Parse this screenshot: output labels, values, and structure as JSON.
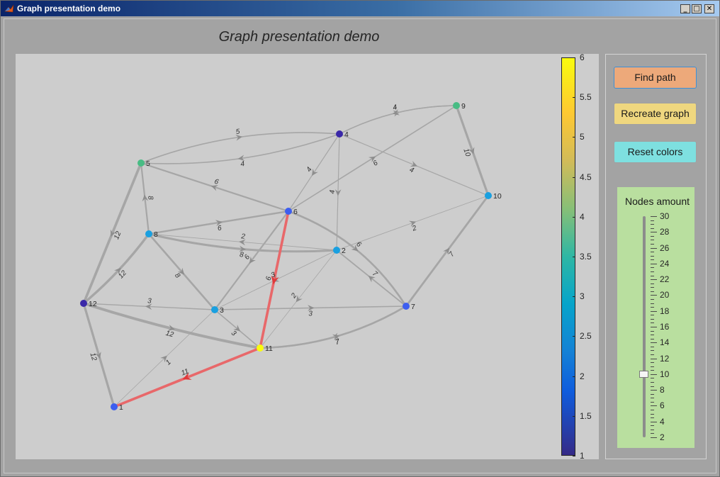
{
  "window": {
    "title": "Graph presentation demo"
  },
  "figure": {
    "title": "Graph presentation demo"
  },
  "buttons": {
    "find_path": "Find path",
    "recreate_graph": "Recreate graph",
    "reset_colors": "Reset colors"
  },
  "slider": {
    "title": "Nodes amount",
    "value": 10,
    "min": 2,
    "max": 30,
    "tick_labels": [
      "30",
      "28",
      "26",
      "24",
      "22",
      "20",
      "18",
      "16",
      "14",
      "12",
      "10",
      "8",
      "6",
      "4",
      "2"
    ]
  },
  "colorbar": {
    "tick_labels": [
      "6",
      "5.5",
      "5",
      "4.5",
      "4",
      "3.5",
      "3",
      "2.5",
      "2",
      "1.5",
      "1"
    ],
    "colors": [
      "#352a87",
      "#0f5cdd",
      "#1481d6",
      "#06a4ca",
      "#2eb7a4",
      "#87bf77",
      "#d1bb59",
      "#fec832",
      "#f9fb0e"
    ]
  },
  "colors": {
    "edge": "#a6a6a6",
    "path": "#e8686a",
    "node_label": "#262626"
  },
  "graph": {
    "nodes": [
      {
        "id": "1",
        "color": "#3d5ef0"
      },
      {
        "id": "2",
        "color": "#1aa0e0"
      },
      {
        "id": "3",
        "color": "#1aa0e0"
      },
      {
        "id": "4",
        "color": "#3a28a8"
      },
      {
        "id": "5",
        "color": "#48bc84"
      },
      {
        "id": "6",
        "color": "#3d5ef0"
      },
      {
        "id": "7",
        "color": "#3d5ef0"
      },
      {
        "id": "8",
        "color": "#1aa0e0"
      },
      {
        "id": "9",
        "color": "#48bc84"
      },
      {
        "id": "10",
        "color": "#1aa0e0"
      },
      {
        "id": "11",
        "color": "#f9fb0e"
      },
      {
        "id": "12",
        "color": "#3a28a8"
      }
    ],
    "edges": [
      {
        "from": "4",
        "to": "5",
        "weight": "4"
      },
      {
        "from": "5",
        "to": "4",
        "weight": "5"
      },
      {
        "from": "4",
        "to": "9",
        "weight": "4"
      },
      {
        "from": "9",
        "to": "4",
        "weight": "4"
      },
      {
        "from": "9",
        "to": "10",
        "weight": "10"
      },
      {
        "from": "4",
        "to": "10",
        "weight": "4"
      },
      {
        "from": "4",
        "to": "6",
        "weight": "4"
      },
      {
        "from": "4",
        "to": "2",
        "weight": "4"
      },
      {
        "from": "6",
        "to": "9",
        "weight": "6"
      },
      {
        "from": "6",
        "to": "5",
        "weight": "6"
      },
      {
        "from": "8",
        "to": "6",
        "weight": "6"
      },
      {
        "from": "8",
        "to": "5",
        "weight": "8"
      },
      {
        "from": "5",
        "to": "12",
        "weight": "12"
      },
      {
        "from": "12",
        "to": "8",
        "weight": "12"
      },
      {
        "from": "2",
        "to": "8",
        "weight": "2"
      },
      {
        "from": "8",
        "to": "2",
        "weight": "8"
      },
      {
        "from": "8",
        "to": "3",
        "weight": "8"
      },
      {
        "from": "6",
        "to": "3",
        "weight": "6"
      },
      {
        "from": "6",
        "to": "11",
        "weight": "6"
      },
      {
        "from": "6",
        "to": "7",
        "weight": "6"
      },
      {
        "from": "2",
        "to": "10",
        "weight": "2"
      },
      {
        "from": "7",
        "to": "2",
        "weight": "7"
      },
      {
        "from": "2",
        "to": "11",
        "weight": "2"
      },
      {
        "from": "2",
        "to": "3",
        "weight": "3"
      },
      {
        "from": "7",
        "to": "10",
        "weight": "7"
      },
      {
        "from": "3",
        "to": "12",
        "weight": "3"
      },
      {
        "from": "3",
        "to": "7",
        "weight": "3"
      },
      {
        "from": "3",
        "to": "11",
        "weight": "3"
      },
      {
        "from": "12",
        "to": "11",
        "weight": "12"
      },
      {
        "from": "12",
        "to": "1",
        "weight": "12"
      },
      {
        "from": "1",
        "to": "3",
        "weight": "1"
      },
      {
        "from": "11",
        "to": "1",
        "weight": "11"
      },
      {
        "from": "7",
        "to": "11",
        "weight": "7"
      },
      {
        "from": "11",
        "to": "7",
        "weight": "7"
      }
    ]
  }
}
